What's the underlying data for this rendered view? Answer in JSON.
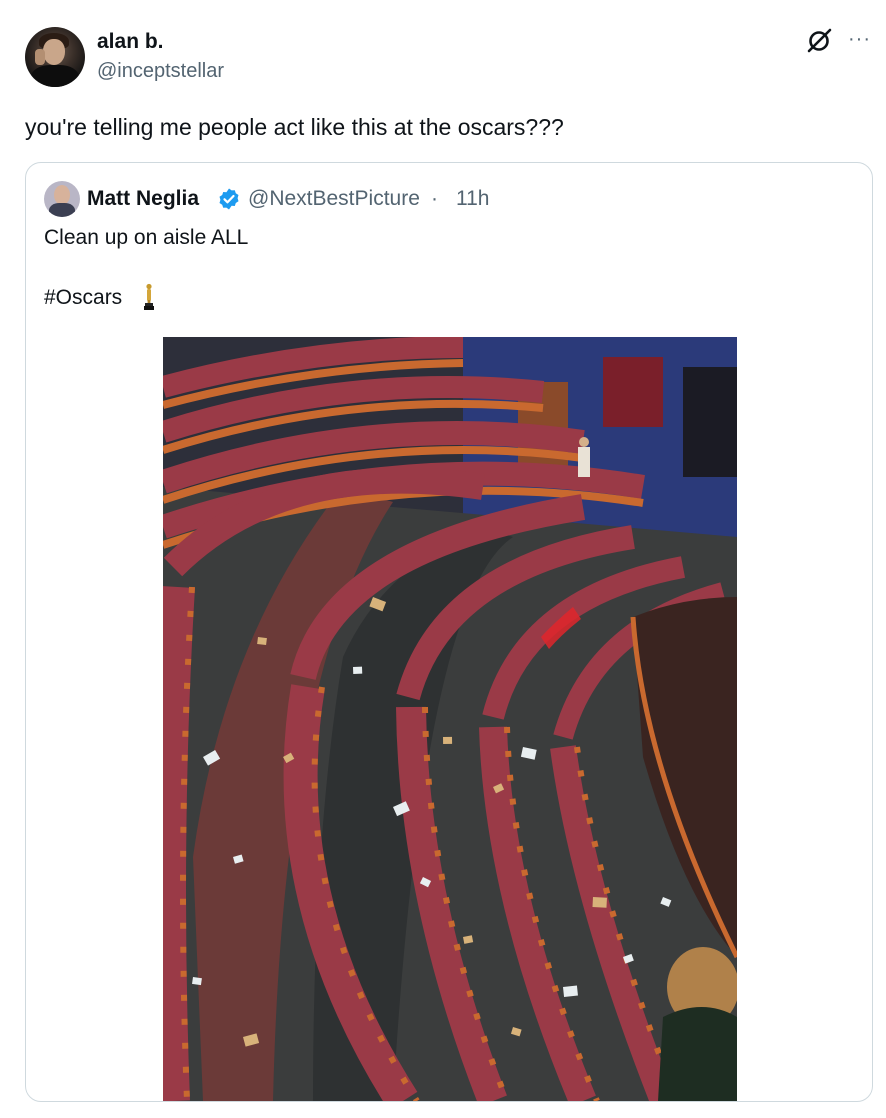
{
  "tweet": {
    "author": {
      "display_name": "alan b.",
      "handle": "@inceptstellar"
    },
    "text": "you're telling me people act like this at the oscars???",
    "header_icons": [
      "grok-icon",
      "more-icon"
    ],
    "more_label": "···"
  },
  "quoted_tweet": {
    "author": {
      "display_name": "Matt Neglia",
      "handle": "@NextBestPicture",
      "verified": true
    },
    "separator": "·",
    "time": "11h",
    "lines": [
      "Clean up on aisle ALL",
      "#Oscars"
    ],
    "emoji": "oscar-statue",
    "media": "photo"
  },
  "colors": {
    "text": "#0f1419",
    "secondary": "#536471",
    "border": "#cfd9de",
    "verified": "#1d9bf0",
    "seat_red": "#9a3a47",
    "seat_wood": "#c9692f",
    "carpet": "#6b3a38",
    "floor": "#3b3d3d"
  }
}
